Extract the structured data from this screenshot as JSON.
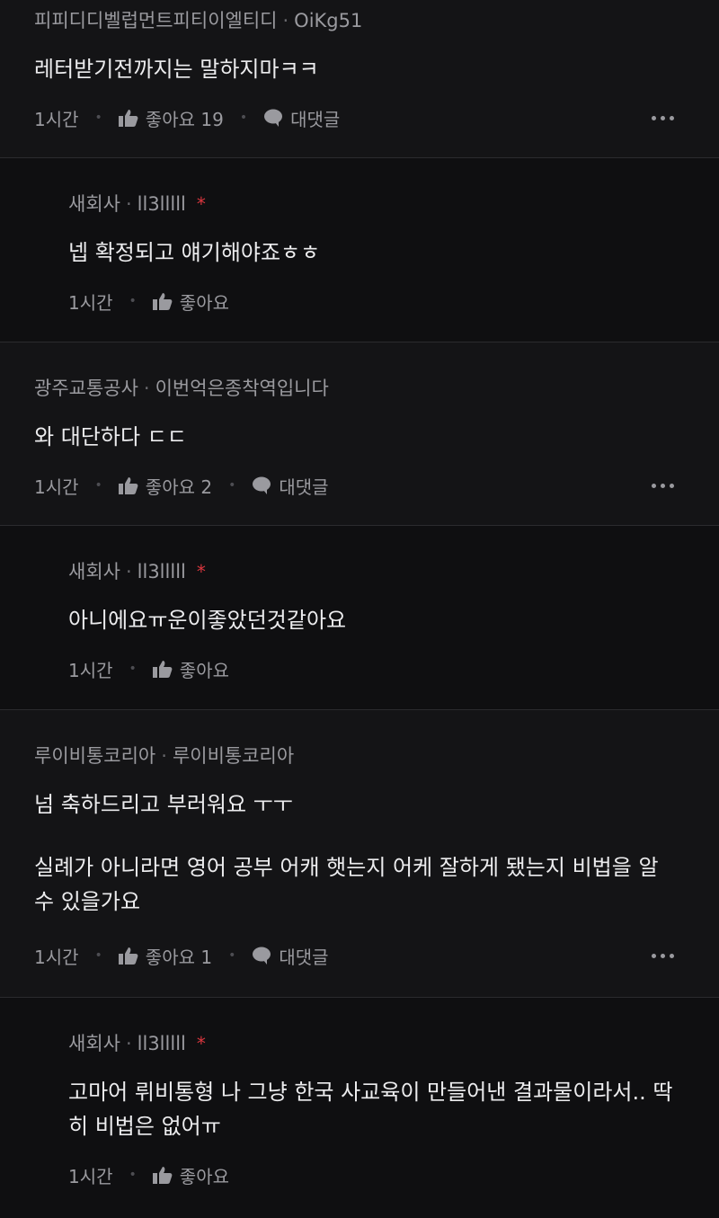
{
  "comments": [
    {
      "author": "피피디디벨럽먼트피티이엘티디",
      "handle": "OiKg51",
      "lines": [
        "레터받기전까지는 말하지마ㅋㅋ"
      ],
      "time": "1시간",
      "like_label": "좋아요 19",
      "reply_label": "대댓글"
    },
    {
      "author": "새회사",
      "handle": "ll3lllll",
      "lines": [
        "넵 확정되고 얘기해야죠ㅎㅎ"
      ],
      "time": "1시간",
      "like_label": "좋아요"
    },
    {
      "author": "광주교통공사",
      "handle": "이번억은종착역입니다",
      "lines": [
        "와 대단하다 ㄷㄷ"
      ],
      "time": "1시간",
      "like_label": "좋아요 2",
      "reply_label": "대댓글"
    },
    {
      "author": "새회사",
      "handle": "ll3lllll",
      "lines": [
        "아니에요ㅠ운이좋았던것같아요"
      ],
      "time": "1시간",
      "like_label": "좋아요"
    },
    {
      "author": "루이비통코리아",
      "handle": "루이비통코리아",
      "lines": [
        "넘 축하드리고 부러워요 ㅜㅜ",
        "실례가 아니라면 영어 공부 어캐 햇는지 어케 잘하게 됐는지 비법을 알 수 있을가요"
      ],
      "time": "1시간",
      "like_label": "좋아요 1",
      "reply_label": "대댓글"
    },
    {
      "author": "새회사",
      "handle": "ll3lllll",
      "lines": [
        "고마어 뤼비통형 나 그냥 한국 사교육이 만들어낸 결과물이라서.. 딱히 비법은 없어ㅠ"
      ],
      "time": "1시간",
      "like_label": "좋아요"
    }
  ],
  "icons": {
    "like": "thumbs-up-icon",
    "reply": "speech-bubble-icon",
    "more": "more-horizontal-icon",
    "author_badge": "asterisk-icon"
  },
  "colors": {
    "background": "#141416",
    "reply_background": "#0f0f11",
    "text": "#ececee",
    "muted": "#9a9a9f",
    "badge": "#d9363e"
  }
}
